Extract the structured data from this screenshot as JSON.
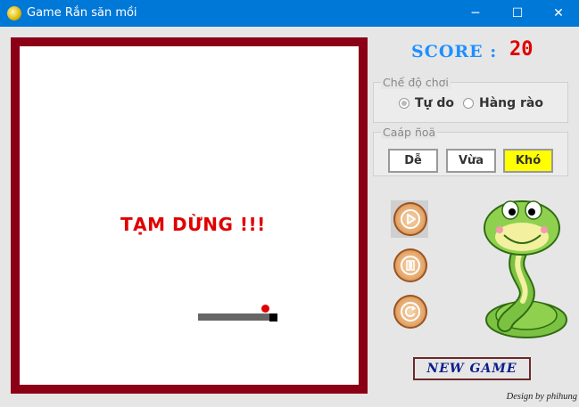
{
  "window": {
    "title": "Game Rắn săn mồi",
    "minimize": "─",
    "maximize": "☐",
    "close": "✕"
  },
  "board": {
    "status_text": "TẠM DỪNG !!!",
    "colors": {
      "border": "#8b0016",
      "snake": "#666666",
      "head": "#000000",
      "food": "#e00000"
    }
  },
  "score": {
    "label": "SCORE :",
    "value": "20"
  },
  "mode_group": {
    "legend": "Chế độ chơi",
    "options": [
      {
        "label": "Tự do",
        "checked": true
      },
      {
        "label": "Hàng rào",
        "checked": false
      }
    ]
  },
  "level_group": {
    "legend": "Caáp ñoä",
    "options": [
      {
        "label": "Dễ",
        "active": false
      },
      {
        "label": "Vừa",
        "active": false
      },
      {
        "label": "Khó",
        "active": true
      }
    ]
  },
  "controls": {
    "play_icon": "play-icon",
    "pause_icon": "pause-icon",
    "restart_icon": "restart-icon"
  },
  "new_game_label": "NEW GAME",
  "credit": "Design by phihung"
}
